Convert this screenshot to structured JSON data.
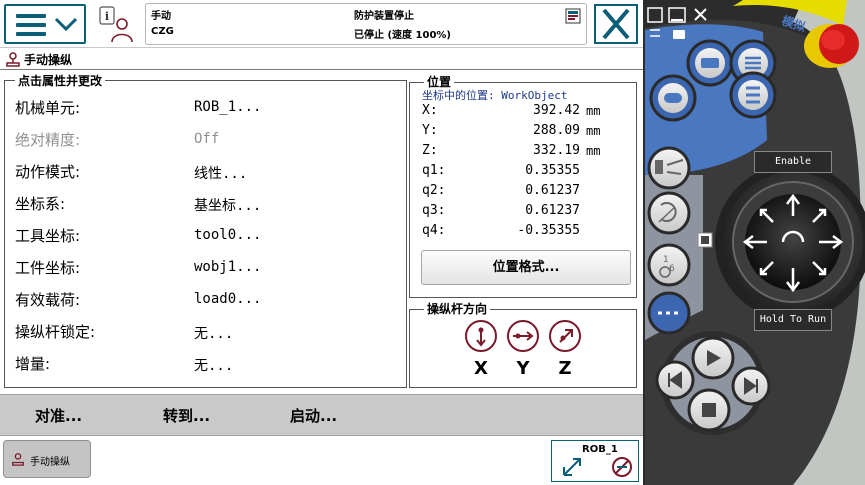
{
  "header": {
    "mode_label": "手动",
    "controller_name": "CZG",
    "status_line1": "防护装置停止",
    "status_line2": "已停止 (速度 100%)"
  },
  "title": "手动操纵",
  "properties": {
    "legend": "点击属性并更改",
    "rows": [
      {
        "label": "机械单元:",
        "value": "ROB_1...",
        "disabled": false
      },
      {
        "label": "绝对精度:",
        "value": "Off",
        "disabled": true
      },
      {
        "label": "动作模式:",
        "value": "线性...",
        "disabled": false
      },
      {
        "label": "坐标系:",
        "value": "基坐标...",
        "disabled": false
      },
      {
        "label": "工具坐标:",
        "value": "tool0...",
        "disabled": false
      },
      {
        "label": "工件坐标:",
        "value": "wobj1...",
        "disabled": false
      },
      {
        "label": "有效载荷:",
        "value": "load0...",
        "disabled": false
      },
      {
        "label": "操纵杆锁定:",
        "value": "无...",
        "disabled": false
      },
      {
        "label": "增量:",
        "value": "无...",
        "disabled": false
      }
    ]
  },
  "position": {
    "legend": "位置",
    "frame_caption": "坐标中的位置: WorkObject",
    "rows": [
      {
        "label": "X:",
        "value": "392.42",
        "unit": "mm"
      },
      {
        "label": "Y:",
        "value": "288.09",
        "unit": "mm"
      },
      {
        "label": "Z:",
        "value": "332.19",
        "unit": "mm"
      },
      {
        "label": "q1:",
        "value": "0.35355",
        "unit": ""
      },
      {
        "label": "q2:",
        "value": "0.61237",
        "unit": ""
      },
      {
        "label": "q3:",
        "value": "0.61237",
        "unit": ""
      },
      {
        "label": "q4:",
        "value": "-0.35355",
        "unit": ""
      }
    ],
    "format_button": "位置格式..."
  },
  "joystick_direction": {
    "legend": "操纵杆方向",
    "axes": [
      "X",
      "Y",
      "Z"
    ]
  },
  "actions": {
    "align": "对准...",
    "goto": "转到...",
    "start": "启动..."
  },
  "taskbar": {
    "task_label": "手动操纵",
    "mech_unit": "ROB_1"
  },
  "pendant": {
    "enable_label": "Enable",
    "hold_label": "Hold To Run"
  },
  "colors": {
    "accent": "#0b5e78",
    "jog_ring": "#7a1a2a",
    "pendant_blue": "#4a78c0",
    "emergency_red": "#d01818",
    "emergency_yellow": "#e8c800"
  }
}
